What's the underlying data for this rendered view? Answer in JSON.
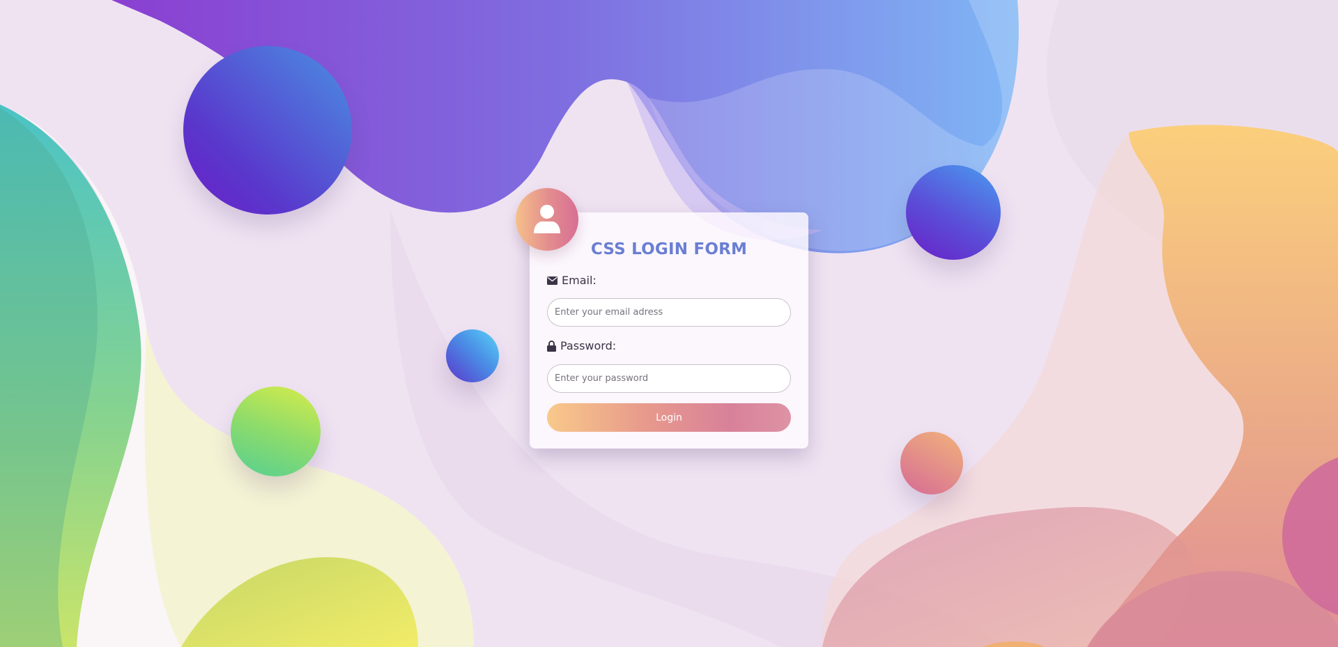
{
  "form": {
    "title": "CSS LOGIN FORM",
    "email_label": "Email:",
    "email_placeholder": "Enter your email adress",
    "password_label": "Password:",
    "password_placeholder": "Enter your password",
    "login_label": "Login"
  },
  "icons": {
    "avatar": "user-icon",
    "email": "envelope-icon",
    "password": "lock-icon"
  },
  "colors": {
    "title": "#6a7fd2",
    "background": "#efe3f2",
    "button_start": "#f8c98a",
    "button_end": "#de93a4"
  }
}
